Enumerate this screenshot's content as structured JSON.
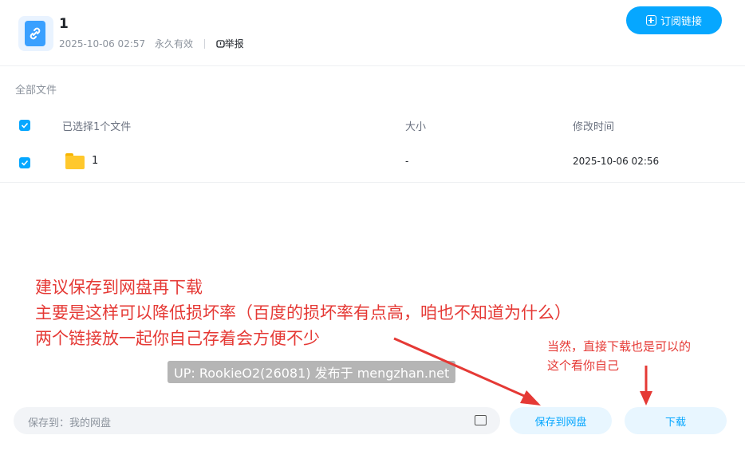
{
  "header": {
    "title": "1",
    "date": "2025-10-06 02:57",
    "validity": "永久有效",
    "report": "举报",
    "subscribe": "订阅链接"
  },
  "breadcrumb": "全部文件",
  "table": {
    "selected_label": "已选择1个文件",
    "col_size": "大小",
    "col_modified": "修改时间",
    "rows": [
      {
        "name": "1",
        "size": "-",
        "modified": "2025-10-06 02:56"
      }
    ]
  },
  "annotations": {
    "line1": "建议保存到网盘再下载",
    "line2": "主要是这样可以降低损坏率（百度的损坏率有点高，咱也不知道为什么）",
    "line3": "两个链接放一起你自己存着会方便不少",
    "note1": "当然，直接下载也是可以的",
    "note2": "这个看你自己",
    "watermark": "UP: RookieO2(26081) 发布于 mengzhan.net"
  },
  "footer": {
    "save_to_label": "保存到：我的网盘",
    "save_button": "保存到网盘",
    "download_button": "下载"
  },
  "colors": {
    "accent": "#06a7ff",
    "annotation": "#e53935"
  }
}
